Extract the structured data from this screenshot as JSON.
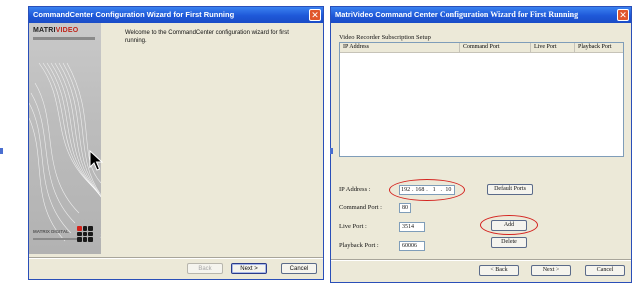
{
  "left_window": {
    "title": "CommandCenter Configuration Wizard for First Running",
    "close_glyph": "✕",
    "brand": {
      "logo_a": "MATRI",
      "logo_b": "VIDEO",
      "bottom_text": "MATRIX DIGITAL"
    },
    "welcome_text": "Welcome to the CommandCenter configuration wizard for first running.",
    "buttons": {
      "back": "Back",
      "next": "Next >",
      "cancel": "Cancel"
    }
  },
  "right_window": {
    "title_a": "MatriVideo Command Center",
    "title_b": "Configuration Wizard for First Running",
    "close_glyph": "✕",
    "section_label": "Video Recorder Subscription Setup",
    "columns": [
      "IP Address",
      "Command Port",
      "Live Port",
      "Playback Port"
    ],
    "form": {
      "ip_label": "IP Address :",
      "ip_octets": [
        "192",
        "168",
        "1",
        "10"
      ],
      "command_port_label": "Command Port :",
      "command_port_value": "80",
      "live_port_label": "Live Port :",
      "live_port_value": "3514",
      "playback_port_label": "Playback Port :",
      "playback_port_value": "60006"
    },
    "buttons": {
      "default_ports": "Default Ports",
      "add": "Add",
      "delete": "Delete",
      "back": "< Back",
      "next": "Next >",
      "cancel": "Cancel"
    }
  },
  "colors": {
    "title_bar": "#1e58d8",
    "highlight": "#d4231f",
    "dialog_bg": "#ece9d8"
  }
}
